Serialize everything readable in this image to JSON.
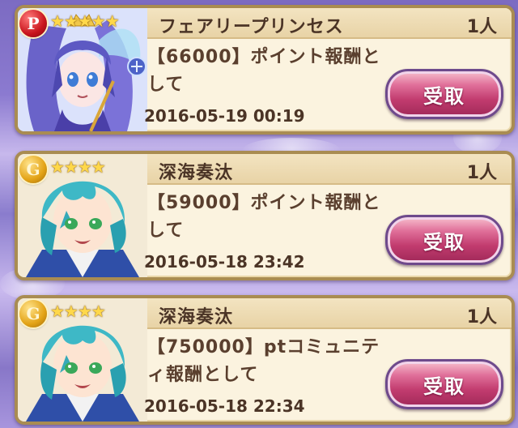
{
  "rewards": [
    {
      "rank": "P",
      "stars": "★★★★★",
      "name": "フェアリープリンセス",
      "count": "1人",
      "description": "【66000】ポイント報酬として",
      "date": "2016-05-19 00:19",
      "button_label": "受取"
    },
    {
      "rank": "G",
      "stars": "★★★★",
      "name": "深海奏汰",
      "count": "1人",
      "description": "【59000】ポイント報酬として",
      "date": "2016-05-18 23:42",
      "button_label": "受取"
    },
    {
      "rank": "G",
      "stars": "★★★★",
      "name": "深海奏汰",
      "count": "1人",
      "description": "【750000】ptコミュニティ報酬として",
      "date": "2016-05-18 22:34",
      "button_label": "受取"
    }
  ],
  "colors": {
    "card_bg": "#fbf3df",
    "card_border": "#a98c52",
    "text": "#4b3426",
    "button": "#c23c6f",
    "rank_p": "#c8141c",
    "rank_g": "#e3a316"
  }
}
